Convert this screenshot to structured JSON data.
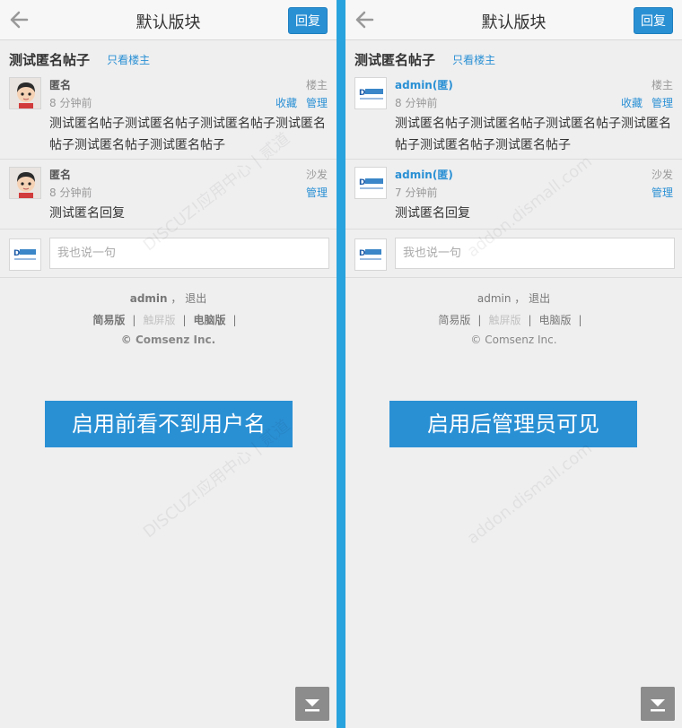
{
  "colors": {
    "accent": "#2a90d4",
    "divider_blue": "#29a3dd",
    "panel_bg": "#efeff0"
  },
  "panels": [
    {
      "header": {
        "title": "默认版块",
        "reply_button": "回复"
      },
      "thread": {
        "title": "测试匿名帖子",
        "only_op": "只看楼主"
      },
      "posts": [
        {
          "author": "匿名",
          "time": "8 分钟前",
          "floor": "楼主",
          "actions": [
            "收藏",
            "管理"
          ],
          "content": "测试匿名帖子测试匿名帖子测试匿名帖子测试匿名帖子测试匿名帖子测试匿名帖子",
          "avatar": "cartoon-avatar"
        },
        {
          "author": "匿名",
          "time": "8 分钟前",
          "floor": "沙发",
          "actions": [
            "管理"
          ],
          "content": "测试匿名回复",
          "avatar": "cartoon-avatar"
        }
      ],
      "reply_placeholder": "我也说一句",
      "footer": {
        "user": "admin",
        "sep": "，",
        "logout": "退出",
        "links": [
          "简易版",
          "触屏版",
          "电脑版"
        ],
        "copyright": "© Comsenz Inc."
      },
      "banner": "启用前看不到用户名"
    },
    {
      "header": {
        "title": "默认版块",
        "reply_button": "回复"
      },
      "thread": {
        "title": "测试匿名帖子",
        "only_op": "只看楼主"
      },
      "posts": [
        {
          "author": "admin(匿)",
          "time": "8 分钟前",
          "floor": "楼主",
          "actions": [
            "收藏",
            "管理"
          ],
          "content": "测试匿名帖子测试匿名帖子测试匿名帖子测试匿名帖子测试匿名帖子测试匿名帖子",
          "avatar": "logo-avatar"
        },
        {
          "author": "admin(匿)",
          "time": "7 分钟前",
          "floor": "沙发",
          "actions": [
            "管理"
          ],
          "content": "测试匿名回复",
          "avatar": "logo-avatar"
        }
      ],
      "reply_placeholder": "我也说一句",
      "footer": {
        "user": "admin",
        "sep": "，",
        "logout": "退出",
        "links": [
          "简易版",
          "触屏版",
          "电脑版"
        ],
        "copyright": "© Comsenz Inc."
      },
      "banner": "启用后管理员可见"
    }
  ],
  "watermark": {
    "brand": "DISCUZ!应用中心 | 贰道",
    "url": "addon.dismall.com"
  }
}
